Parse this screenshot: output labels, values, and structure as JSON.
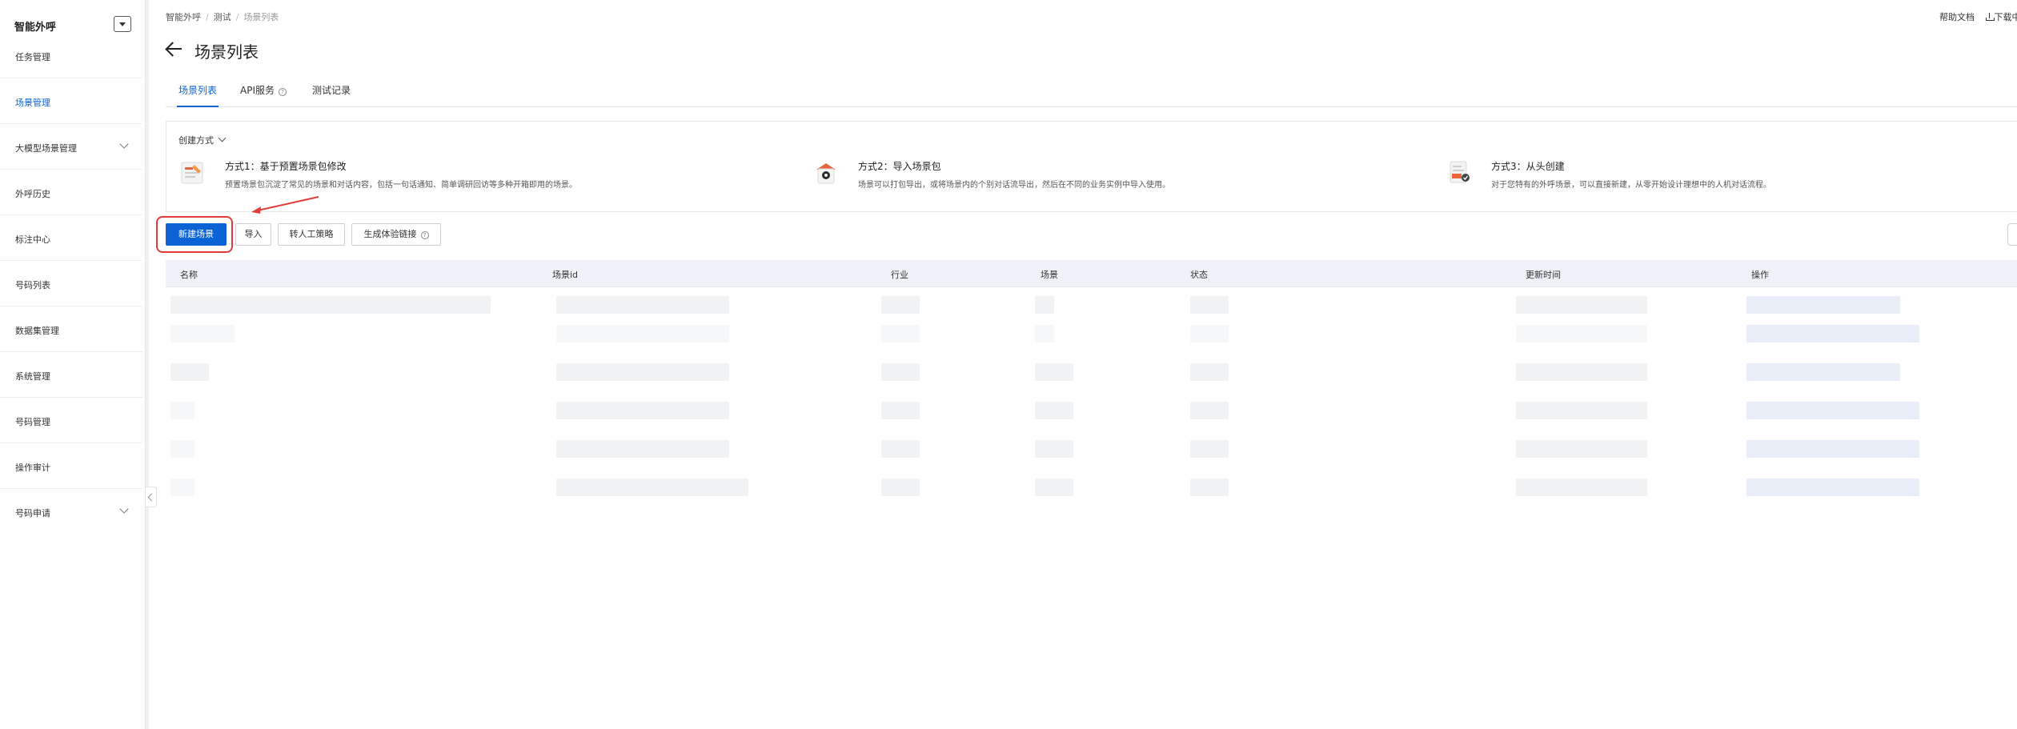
{
  "sidebar": {
    "app_title": "智能外呼",
    "items": [
      {
        "label": "任务管理",
        "active": false,
        "expandable": false
      },
      {
        "label": "场景管理",
        "active": true,
        "expandable": false
      },
      {
        "label": "大模型场景管理",
        "active": false,
        "expandable": true
      },
      {
        "label": "外呼历史",
        "active": false,
        "expandable": false
      },
      {
        "label": "标注中心",
        "active": false,
        "expandable": false
      },
      {
        "label": "号码列表",
        "active": false,
        "expandable": false
      },
      {
        "label": "数据集管理",
        "active": false,
        "expandable": false
      },
      {
        "label": "系统管理",
        "active": false,
        "expandable": false
      },
      {
        "label": "号码管理",
        "active": false,
        "expandable": false
      },
      {
        "label": "操作审计",
        "active": false,
        "expandable": false
      },
      {
        "label": "号码申请",
        "active": false,
        "expandable": true
      }
    ]
  },
  "breadcrumb": [
    "智能外呼",
    "测试",
    "场景列表"
  ],
  "top_links": {
    "help": "帮助文档",
    "download": "下载中"
  },
  "page": {
    "title": "场景列表"
  },
  "tabs": [
    {
      "label": "场景列表",
      "active": true
    },
    {
      "label": "API服务",
      "active": false
    },
    {
      "label": "测试记录",
      "active": false
    }
  ],
  "create_methods": {
    "label": "创建方式",
    "methods": [
      {
        "title": "方式1：基于预置场景包修改",
        "desc": "预置场景包沉淀了常见的场景和对话内容，包括一句话通知、简单调研回访等多种开箱即用的场景。",
        "icon": "template-icon"
      },
      {
        "title": "方式2：导入场景包",
        "desc": "场景可以打包导出，或将场景内的个别对话流导出，然后在不同的业务实例中导入使用。",
        "icon": "import-package-icon"
      },
      {
        "title": "方式3：从头创建",
        "desc": "对于您特有的外呼场景，可以直接新建，从零开始设计理想中的人机对话流程。",
        "icon": "document-create-icon"
      }
    ]
  },
  "toolbar": {
    "new_scene": "新建场景",
    "import": "导入",
    "transfer_strategy": "转人工策略",
    "generate_link": "生成体验链接"
  },
  "table": {
    "columns": [
      "名称",
      "场景id",
      "行业",
      "场景",
      "状态",
      "更新时间",
      "操作"
    ]
  },
  "colors": {
    "accent": "#0b63d6",
    "annotation": "#e03c3c"
  }
}
